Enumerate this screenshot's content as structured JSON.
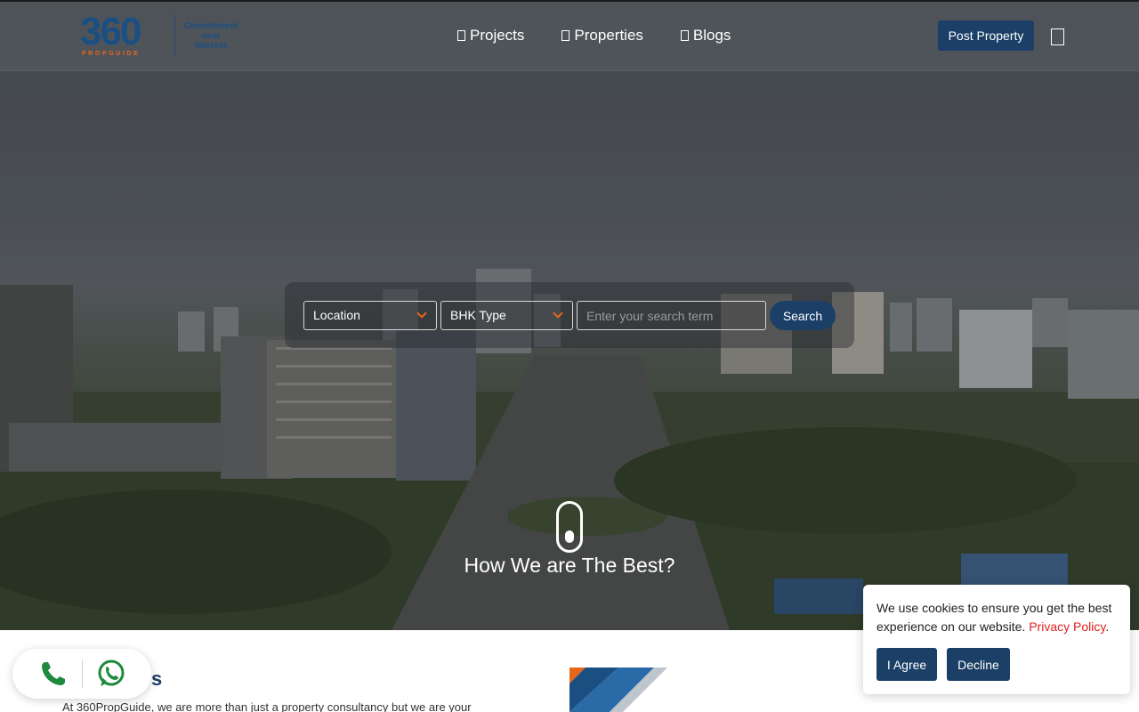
{
  "header": {
    "logo": {
      "number": "360",
      "wordmark": "PROPGUIDE",
      "tagline": [
        "Commitment",
        "over",
        "Interest"
      ]
    },
    "nav": [
      {
        "label": "Projects",
        "icon": "building-icon"
      },
      {
        "label": "Properties",
        "icon": "home-icon"
      },
      {
        "label": "Blogs",
        "icon": "blog-icon"
      }
    ],
    "post_property_label": "Post Property",
    "menu_icon": "menu-icon"
  },
  "search": {
    "location_label": "Location",
    "bhk_label": "BHK Type",
    "input_placeholder": "Enter your search term",
    "input_value": "",
    "button_label": "Search"
  },
  "hero": {
    "tagline": "How We are The Best?"
  },
  "about": {
    "title_visible": "s",
    "text": "At 360PropGuide, we are more than just a property consultancy but we are your"
  },
  "contact": {
    "phone_icon": "phone-icon",
    "whatsapp_icon": "whatsapp-icon"
  },
  "cookie": {
    "message": "We use cookies to ensure you get the best experience on our website.",
    "link_label": "Privacy Policy",
    "link_suffix": ".",
    "agree_label": "I Agree",
    "decline_label": "Decline"
  },
  "colors": {
    "brand_navy": "#1b3f66",
    "brand_orange": "#e8661c",
    "link_red": "#e02020",
    "whatsapp_green": "#1e8a3c"
  }
}
